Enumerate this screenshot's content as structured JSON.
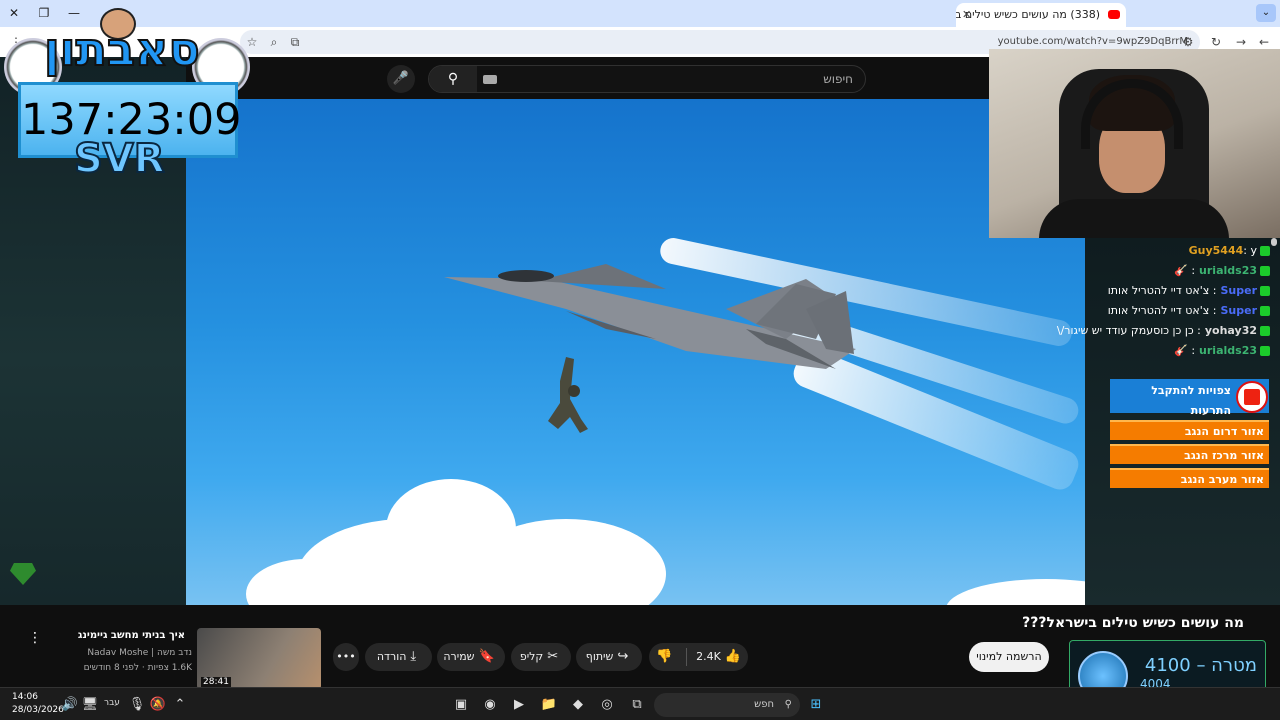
{
  "browser": {
    "tab_title": "(338) מה עושים כשיש טילים ב",
    "url": "youtube.com/watch?v=9wpZ9DqBrrM"
  },
  "youtube": {
    "search_placeholder": "חיפוש",
    "video_title": "מה עושים כשיש טילים בישראל???",
    "subscribe_label": "הרשמה למינוי",
    "likes": "2.4K",
    "share_label": "שיתוף",
    "clip_label": "קליפ",
    "save_label": "שמירה",
    "download_label": "הורדה",
    "more_label": "•••",
    "recommended": {
      "title": "איך בניתי מחשב גיימינג",
      "channel": "נדב משה | Nadav Moshe",
      "meta": "1.6K צפיות · לפני 8 חודשים",
      "duration": "28:41"
    }
  },
  "overlay": {
    "logo_text": "סאבתון",
    "timer": "137:23:09",
    "tag": "SVR"
  },
  "chat": [
    {
      "user": "Guy5444",
      "message": "y",
      "color": "#e0a021"
    },
    {
      "user": "urialds23",
      "message": "",
      "color": "#3cb371"
    },
    {
      "user": "Super",
      "message": "צ'אט דיי להטריל אותו",
      "color": "#4a6cf7"
    },
    {
      "user": "Super",
      "message": "צ'אט דיי להטריל אותו",
      "color": "#4a6cf7"
    },
    {
      "user": "yohay32",
      "message": "כן כן כוסעמק עודד יש שיגור/\\",
      "color": "#dddddd"
    },
    {
      "user": "urialds23",
      "message": "",
      "color": "#3cb371"
    }
  ],
  "alerts": {
    "header": "צפויות להתקבל התרעות",
    "areas": [
      "אזור דרום הנגב",
      "אזור מרכז הנגב",
      "אזור מערב הנגב"
    ]
  },
  "goal": {
    "label": "מטרה",
    "target": "4100",
    "current": "4004"
  },
  "taskbar": {
    "search_placeholder": "חפש",
    "time": "14:06",
    "date": "28/03/2026",
    "lang": "עבר"
  }
}
